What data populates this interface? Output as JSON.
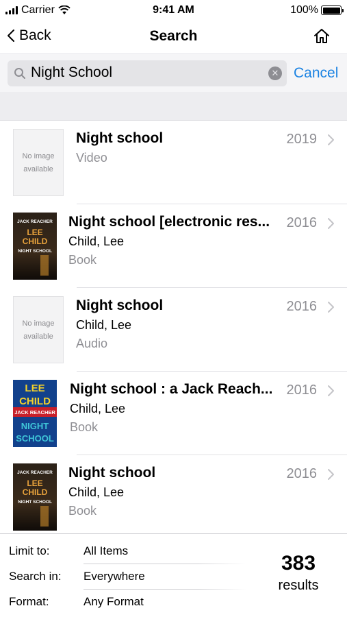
{
  "status_bar": {
    "carrier": "Carrier",
    "time": "9:41 AM",
    "battery": "100%"
  },
  "nav": {
    "back_label": "Back",
    "title": "Search"
  },
  "search": {
    "value": "Night School",
    "cancel_label": "Cancel"
  },
  "results": [
    {
      "title": "Night school",
      "author": "",
      "format": "Video",
      "year": "2019",
      "cover": "No image available"
    },
    {
      "title": "Night school [electronic res...",
      "author": "Child, Lee",
      "format": "Book",
      "year": "2016",
      "cover_lines": [
        "JACK REACHER",
        "LEE",
        "CHILD",
        "NIGHT SCHOOL"
      ]
    },
    {
      "title": "Night school",
      "author": "Child, Lee",
      "format": "Audio",
      "year": "2016",
      "cover": "No image available"
    },
    {
      "title": "Night school : a Jack Reach...",
      "author": "Child, Lee",
      "format": "Book",
      "year": "2016",
      "cover_lines": [
        "LEE",
        "CHILD",
        "JACK REACHER",
        "NIGHT",
        "SCHOOL"
      ]
    },
    {
      "title": "Night school",
      "author": "Child, Lee",
      "format": "Book",
      "year": "2016",
      "cover_lines": [
        "JACK REACHER",
        "LEE",
        "CHILD",
        "NIGHT SCHOOL"
      ]
    }
  ],
  "filters": [
    {
      "label": "Limit to:",
      "value": "All Items"
    },
    {
      "label": "Search in:",
      "value": "Everywhere"
    },
    {
      "label": "Format:",
      "value": "Any Format"
    }
  ],
  "summary": {
    "count": "383",
    "label": "results"
  },
  "colors": {
    "accent": "#1a82e2",
    "secondary_text": "#8e8e93"
  }
}
